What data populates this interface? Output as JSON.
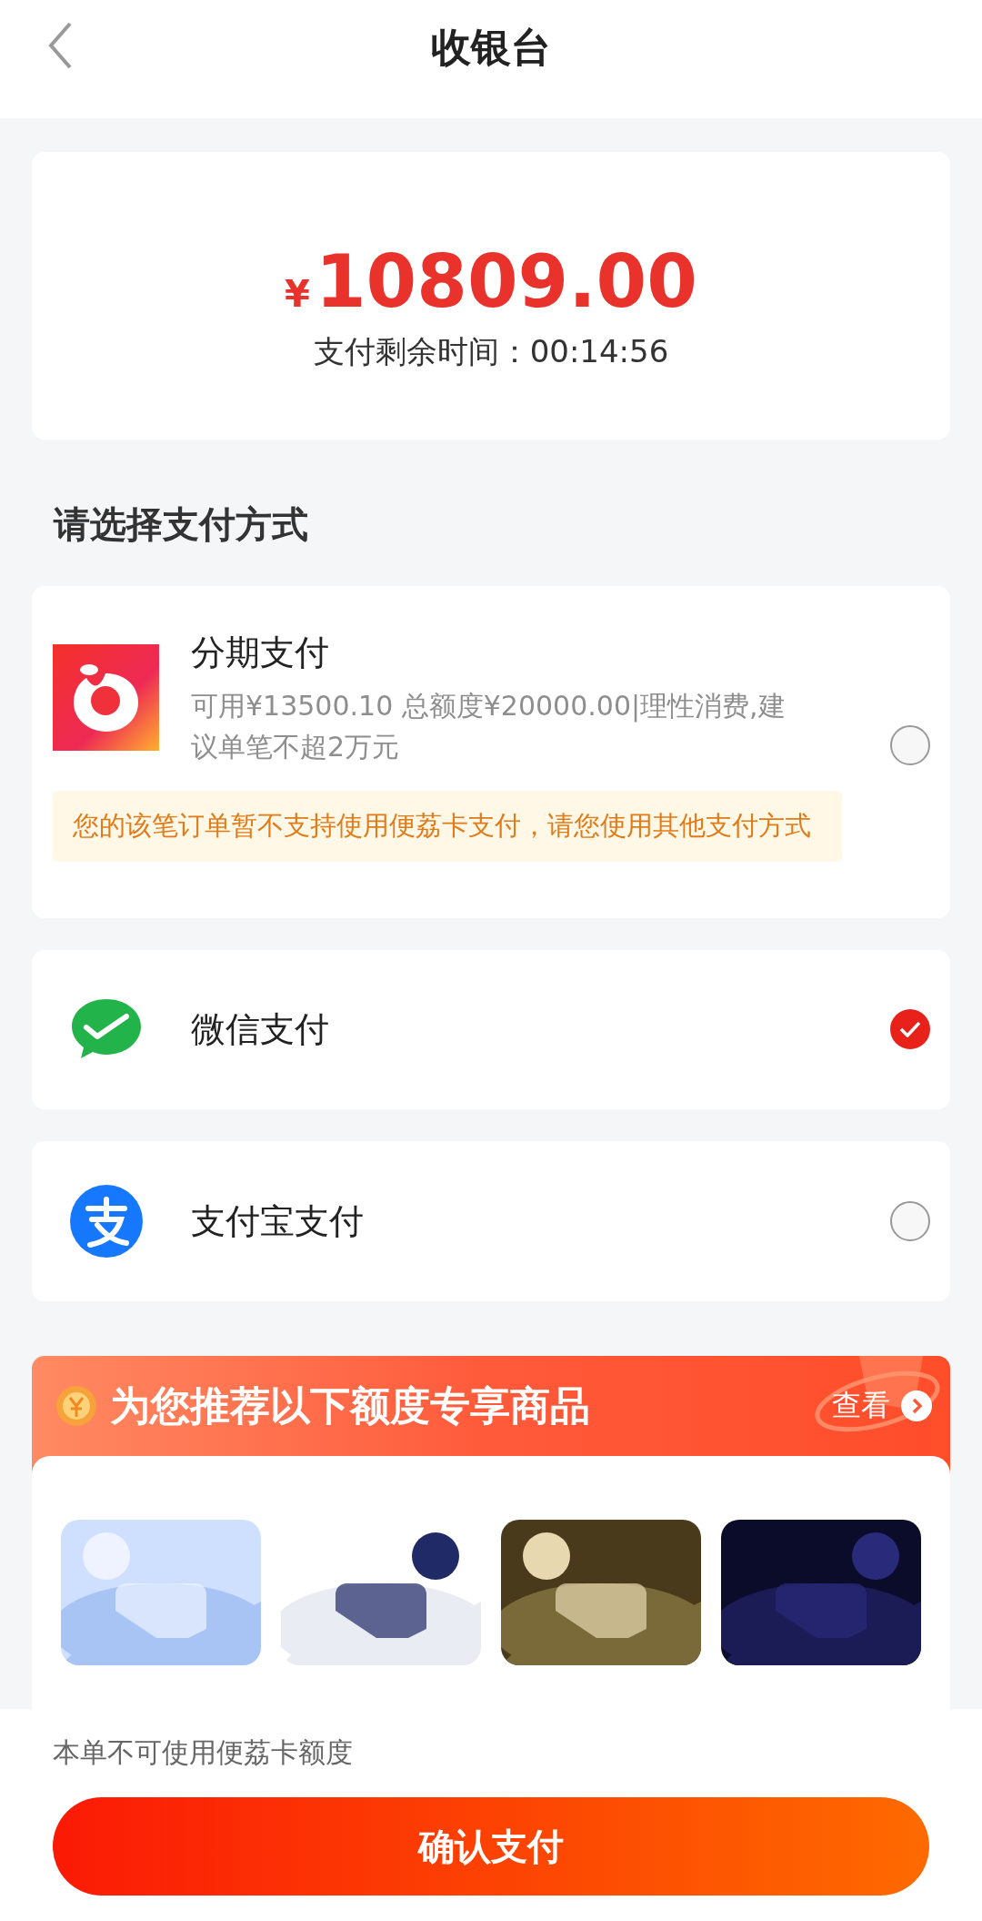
{
  "header": {
    "title": "收银台"
  },
  "amount": {
    "currency": "¥",
    "value": "10809.00",
    "timer": "支付剩余时间：00:14:56"
  },
  "section_title": "请选择支付方式",
  "methods": [
    {
      "kind": "installment",
      "name": "分期支付",
      "detail": "可用¥13500.10 总额度¥20000.00|理性消费,建议单笔不超2万元",
      "notice": "您的该笔订单暂不支持使用便荔卡支付，请您使用其他支付方式",
      "selected": false
    },
    {
      "kind": "wechat",
      "name": "微信支付",
      "selected": true
    },
    {
      "kind": "alipay",
      "name": "支付宝支付",
      "selected": false
    }
  ],
  "promo": {
    "title": "为您推荐以下额度专享商品",
    "link": "查看"
  },
  "footer": {
    "note": "本单不可使用便荔卡额度",
    "button": "确认支付"
  }
}
